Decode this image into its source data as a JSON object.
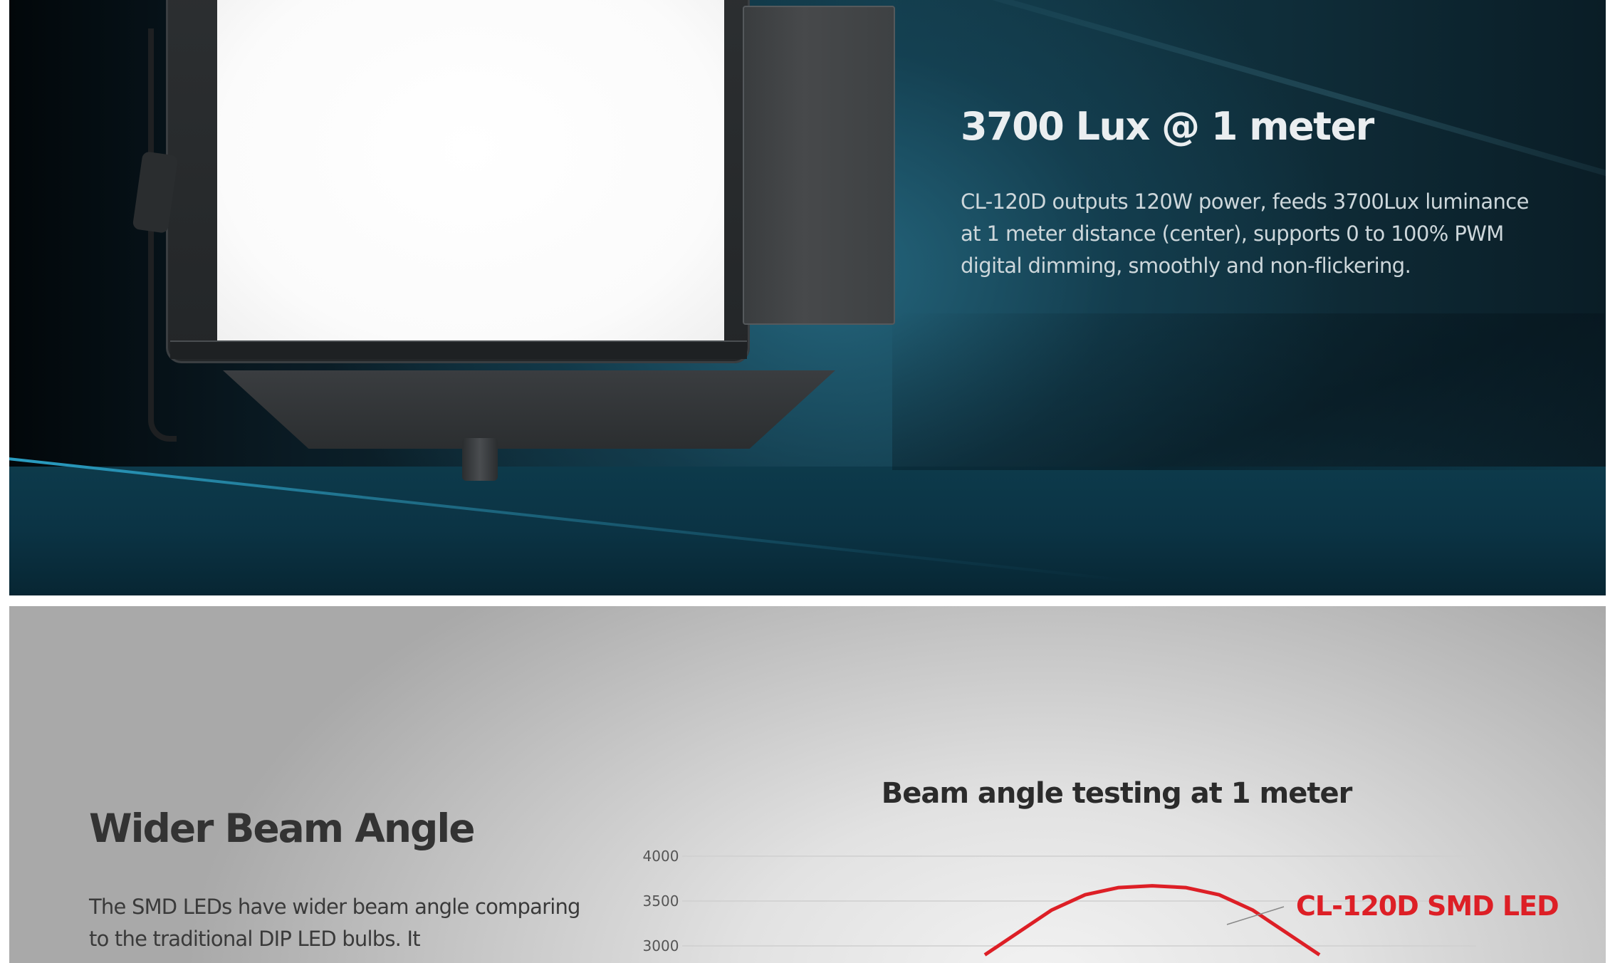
{
  "hero": {
    "title": "3700 Lux @ 1 meter",
    "description": "CL-120D outputs 120W power, feeds 3700Lux luminance at 1 meter distance (center), supports 0 to 100% PWM digital dimming, smoothly and non-flickering."
  },
  "beam_section": {
    "title": "Wider Beam Angle",
    "description": "The SMD LEDs have wider beam angle comparing to the traditional DIP LED bulbs. It"
  },
  "chart_data": {
    "type": "line",
    "title": "Beam angle testing at 1 meter",
    "y_ticks": [
      "4000",
      "3500",
      "3000"
    ],
    "ylim": [
      3000,
      4000
    ],
    "grid": true,
    "annotation": "CL-120D SMD LED",
    "series": [
      {
        "name": "CL-120D SMD LED",
        "color": "#dd1f26",
        "x": [
          -1.0,
          -0.8,
          -0.6,
          -0.4,
          -0.2,
          0.0,
          0.2,
          0.4,
          0.6,
          0.8,
          1.0
        ],
        "values": [
          2900,
          3150,
          3400,
          3570,
          3650,
          3670,
          3650,
          3570,
          3400,
          3150,
          2900
        ]
      }
    ]
  },
  "colors": {
    "hero_title": "#eaeef0",
    "hero_body": "#cdd7db",
    "section_title": "#333333",
    "chart_series": "#dd1f26"
  }
}
